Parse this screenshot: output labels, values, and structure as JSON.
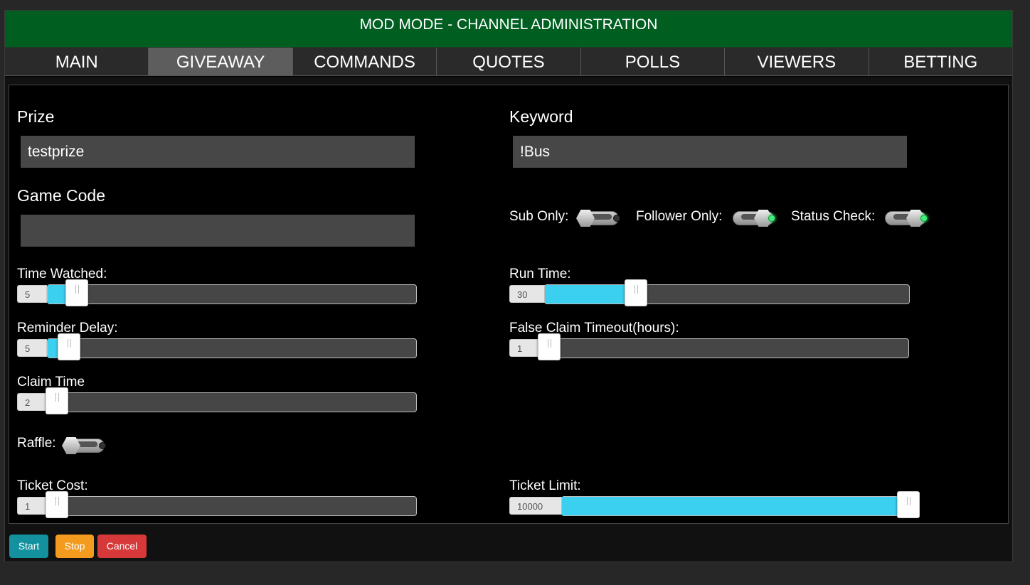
{
  "header": {
    "title": "MOD MODE - CHANNEL ADMINISTRATION"
  },
  "tabs": [
    "MAIN",
    "GIVEAWAY",
    "COMMANDS",
    "QUOTES",
    "POLLS",
    "VIEWERS",
    "BETTING"
  ],
  "active_tab": "GIVEAWAY",
  "fields": {
    "prize": {
      "label": "Prize",
      "value": "testprize"
    },
    "keyword": {
      "label": "Keyword",
      "value": "!Bus"
    },
    "game_code": {
      "label": "Game Code",
      "value": ""
    }
  },
  "toggles": {
    "sub_only": {
      "label": "Sub Only:",
      "on": false
    },
    "follower_only": {
      "label": "Follower Only:",
      "on": true
    },
    "status_check": {
      "label": "Status Check:",
      "on": true
    },
    "raffle": {
      "label": "Raffle:",
      "on": false
    }
  },
  "sliders": {
    "time_watched": {
      "label": "Time Watched:",
      "value": "5",
      "fill_fraction": 0.08
    },
    "reminder_delay": {
      "label": "Reminder Delay:",
      "value": "5",
      "fill_fraction": 0.06
    },
    "claim_time": {
      "label": "Claim Time",
      "value": "2",
      "fill_fraction": 0.0
    },
    "ticket_cost": {
      "label": "Ticket Cost:",
      "value": "1",
      "fill_fraction": 0.0
    },
    "run_time": {
      "label": "Run Time:",
      "value": "30",
      "fill_fraction": 0.25
    },
    "false_claim_timeout": {
      "label": "False Claim Timeout(hours):",
      "value": "1",
      "fill_fraction": 0.0
    },
    "ticket_limit": {
      "label": "Ticket Limit:",
      "value": "10000",
      "fill_fraction": 1.0
    }
  },
  "buttons": {
    "start": {
      "label": "Start",
      "color": "#13919e"
    },
    "stop": {
      "label": "Stop",
      "color": "#f39b1f"
    },
    "cancel": {
      "label": "Cancel",
      "color": "#d7393a"
    }
  },
  "colors": {
    "header_green": "#005f20",
    "slider_fill": "#3bd0ef",
    "active_tab": "#5d5d5d"
  }
}
